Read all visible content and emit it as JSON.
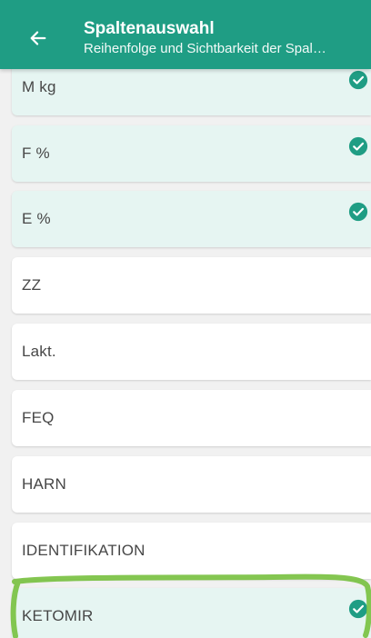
{
  "header": {
    "title": "Spaltenauswahl",
    "subtitle": "Reihenfolge und Sichtbarkeit der Spal…"
  },
  "colors": {
    "primary": "#1f9d84",
    "selected_row_bg": "#e6f5f2",
    "annotation": "#7ac142"
  },
  "columns": [
    {
      "label": "M kg",
      "selected": true
    },
    {
      "label": "F %",
      "selected": true
    },
    {
      "label": "E %",
      "selected": true
    },
    {
      "label": "ZZ",
      "selected": false
    },
    {
      "label": "Lakt.",
      "selected": false
    },
    {
      "label": "FEQ",
      "selected": false
    },
    {
      "label": "HARN",
      "selected": false
    },
    {
      "label": "IDENTIFIKATION",
      "selected": false
    },
    {
      "label": "KETOMIR",
      "selected": true
    }
  ]
}
